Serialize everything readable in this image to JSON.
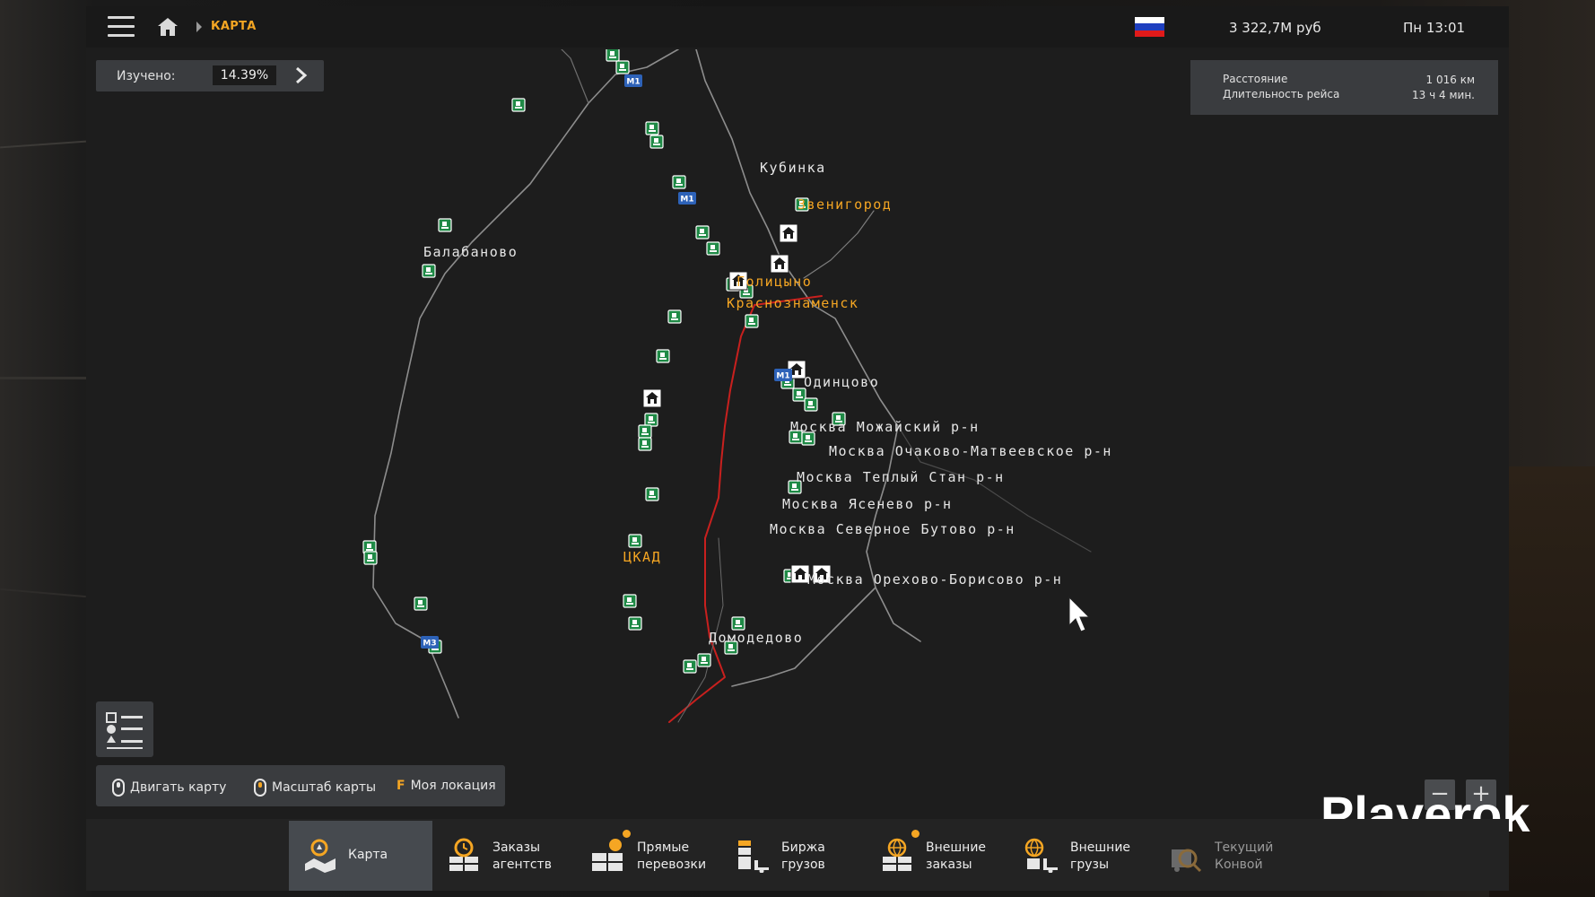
{
  "topbar": {
    "breadcrumb": "КАРТА",
    "money": "3 322,7М руб",
    "clock": "Пн 13:01",
    "flag_colors": [
      "#ffffff",
      "#1f3fbf",
      "#e01a1a"
    ]
  },
  "explored": {
    "label": "Изучено:",
    "value": "14.39%"
  },
  "route": {
    "distance_label": "Расстояние",
    "distance_value": "1 016 км",
    "duration_label": "Длительность рейса",
    "duration_value": "13 ч 4 мин."
  },
  "map": {
    "cities": [
      {
        "name": "Кубинка",
        "highlight": false
      },
      {
        "name": "Звенигород",
        "highlight": true
      },
      {
        "name": "Балабаново",
        "highlight": false
      },
      {
        "name": "Голицыно",
        "highlight": true
      },
      {
        "name": "Краснознаменск",
        "highlight": true
      },
      {
        "name": "Одинцово",
        "highlight": false
      },
      {
        "name": "Москва Можайский р-н",
        "highlight": false
      },
      {
        "name": "Москва Очаково-Матвеевское р-н",
        "highlight": false
      },
      {
        "name": "Москва Теплый Стан р-н",
        "highlight": false
      },
      {
        "name": "Москва Ясенево р-н",
        "highlight": false
      },
      {
        "name": "Москва Северное Бутово р-н",
        "highlight": false
      },
      {
        "name": "ЦКАД",
        "highlight": true
      },
      {
        "name": "Москва Орехово-Борисово р-н",
        "highlight": false
      },
      {
        "name": "Домодедово",
        "highlight": false
      }
    ],
    "road_signs": [
      "M1",
      "M1",
      "M1",
      "M3"
    ],
    "route_color": "#c8201e",
    "road_color": "#8a8a8a"
  },
  "controls": {
    "move_map": "Двигать карту",
    "zoom_map": "Масштаб карты",
    "my_location_key": "F",
    "my_location": "Моя локация",
    "zoom_out": "−",
    "zoom_in": "+"
  },
  "watermark": "Playerok",
  "tabs": [
    {
      "line1": "Карта",
      "line2": "",
      "icon": "map-icon",
      "active": true,
      "dot": false
    },
    {
      "line1": "Заказы",
      "line2": "агентств",
      "icon": "agency-orders-icon",
      "active": false,
      "dot": false
    },
    {
      "line1": "Прямые",
      "line2": "перевозки",
      "icon": "direct-transport-icon",
      "active": false,
      "dot": true
    },
    {
      "line1": "Биржа",
      "line2": "грузов",
      "icon": "cargo-market-icon",
      "active": false,
      "dot": false
    },
    {
      "line1": "Внешние",
      "line2": "заказы",
      "icon": "external-orders-icon",
      "active": false,
      "dot": true
    },
    {
      "line1": "Внешние",
      "line2": "грузы",
      "icon": "external-cargo-icon",
      "active": false,
      "dot": false
    },
    {
      "line1": "Текущий",
      "line2": "Конвой",
      "icon": "convoy-icon",
      "active": false,
      "dot": false
    }
  ]
}
